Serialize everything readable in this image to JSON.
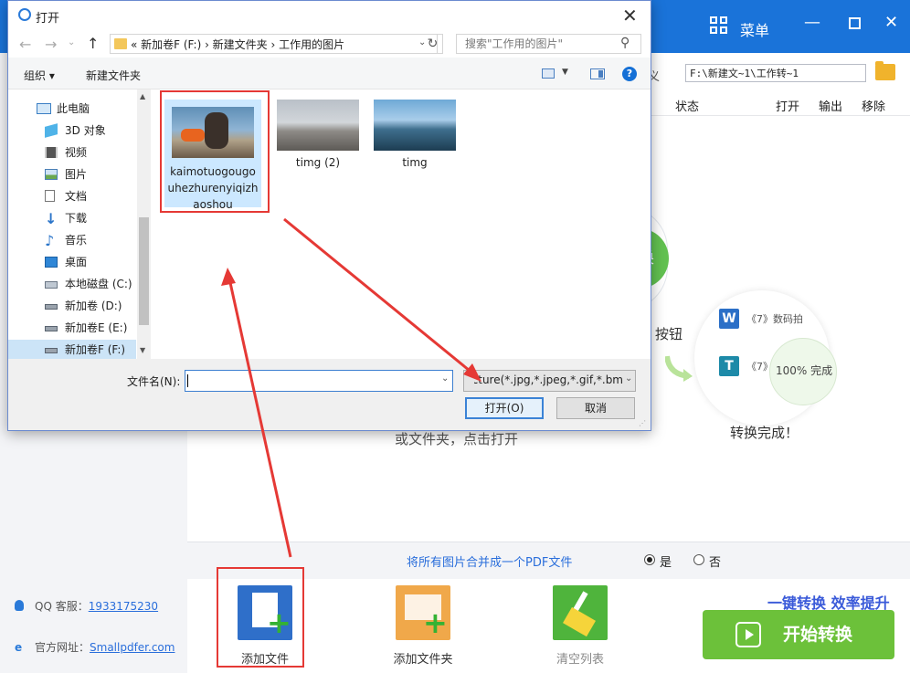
{
  "app": {
    "menu_label": "菜单",
    "path_prefix": "义",
    "path_value": "F:\\新建文~1\\工作转~1",
    "columns": [
      "状态",
      "打开",
      "输出",
      "移除"
    ],
    "deco_text": "换",
    "button_hint": "按钮",
    "doc_rows": [
      {
        "icon_letter": "W",
        "text": "《7》数码拍"
      },
      {
        "icon_letter": "T",
        "text": "《7》"
      }
    ],
    "progress_text": "100%  完成",
    "done_label": "转换完成！",
    "drop_hint": "或文件夹，点击打开",
    "merge": {
      "label": "将所有图片合并成一个PDF文件",
      "yes": "是",
      "no": "否",
      "selected": "是"
    },
    "tools": [
      {
        "label": "添加文件",
        "icon": "add-file-icon"
      },
      {
        "label": "添加文件夹",
        "icon": "add-folder-icon"
      },
      {
        "label": "清空列表",
        "icon": "clear-list-icon"
      }
    ],
    "slogan": "一键转换 效率提升",
    "start_label": "开始转换",
    "qq_label": "QQ 客服：",
    "qq_value": "1933175230",
    "site_label": "官方网址：",
    "site_value": "Smallpdfer.com"
  },
  "dialog": {
    "title": "打开",
    "crumbs": "« 新加卷F (F:)  ›  新建文件夹  ›  工作用的图片",
    "search_placeholder": "搜索\"工作用的图片\"",
    "organize": "组织 ▾",
    "new_folder": "新建文件夹",
    "nav_items": [
      "此电脑",
      "3D 对象",
      "视频",
      "图片",
      "文档",
      "下载",
      "音乐",
      "桌面",
      "本地磁盘 (C:)",
      "新加卷 (D:)",
      "新加卷E (E:)",
      "新加卷F (F:)"
    ],
    "selected_nav": "新加卷F (F:)",
    "files": [
      {
        "name": "kaimotuogougouhezhurenyiqizhaoshou",
        "selected": true
      },
      {
        "name": "timg (2)",
        "selected": false
      },
      {
        "name": "timg",
        "selected": false
      }
    ],
    "filename_label": "文件名(N):",
    "filename_value": "",
    "filter_value": "Picture(*.jpg,*.jpeg,*.gif,*.bm",
    "open_label": "打开(O)",
    "cancel_label": "取消"
  },
  "colors": {
    "accent": "#1a73d9",
    "start": "#6cc13a",
    "annotation": "#e53935",
    "selection": "#cce8ff"
  }
}
